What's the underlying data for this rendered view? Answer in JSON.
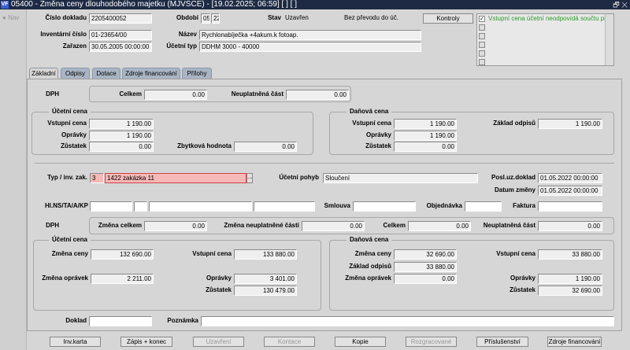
{
  "window": {
    "title": "05400 - Změna ceny dlouhodobého majetku (MJVSCE) - [19.02.2025; 06:59]  [ ]  [ ]",
    "controls": "🗗 ✕"
  },
  "nav": {
    "label": "Nav"
  },
  "header": {
    "cislo_dokladu": {
      "label": "Číslo dokladu",
      "value": "2205400052"
    },
    "obdobi": {
      "label": "Období",
      "month": "05",
      "year": "22"
    },
    "stav": {
      "label": "Stav",
      "value": "Uzavřen"
    },
    "prevod": "Bez převodu do úč.",
    "kontroly_button": "Kontroly",
    "inventarni_cislo": {
      "label": "Inventární číslo",
      "value": "01-23654/00"
    },
    "nazev": {
      "label": "Název",
      "value": "Rychlonabíječka +4akum.k fotoap."
    },
    "zarazen": {
      "label": "Zařazen",
      "value": "30.05.2005 00:00:00"
    },
    "ucetni_typ": {
      "label": "Účetní typ",
      "value": "DDHM 3000 - 40000"
    },
    "messages": [
      {
        "checked": true,
        "text": "Vstupní cena účetní neodpovídá součtu připojených"
      },
      {
        "checked": false,
        "text": ""
      },
      {
        "checked": false,
        "text": ""
      },
      {
        "checked": false,
        "text": ""
      },
      {
        "checked": false,
        "text": ""
      },
      {
        "checked": false,
        "text": ""
      }
    ]
  },
  "tabs": [
    "Základní",
    "Odpisy",
    "Dotace",
    "Zdroje financování",
    "Přílohy"
  ],
  "top": {
    "dph": {
      "label": "DPH",
      "celkem_label": "Celkem",
      "celkem": "0.00",
      "neupl_label": "Neuplatněná část",
      "neupl": "0.00"
    },
    "ucetni": {
      "title": "Účetní cena",
      "vstupni_label": "Vstupní cena",
      "vstupni": "1 190.00",
      "opravky_label": "Oprávky",
      "opravky": "1 190.00",
      "zustatek_label": "Zůstatek",
      "zustatek": "0.00",
      "zbytkova_label": "Zbytková hodnota",
      "zbytkova": "0.00"
    },
    "danova": {
      "title": "Daňová cena",
      "vstupni_label": "Vstupní cena",
      "vstupni": "1 190.00",
      "opravky_label": "Oprávky",
      "opravky": "1 190.00",
      "zustatek_label": "Zůstatek",
      "zustatek": "0.00",
      "zaklad_label": "Základ odpisů",
      "zaklad": "1 190.00"
    }
  },
  "change": {
    "typ_label": "Typ / inv. zak.",
    "typ": "3",
    "zakazka": "1422 zakázka 11",
    "ellipsis": "...",
    "pohyb_label": "Účetní pohyb",
    "pohyb": "Sloučení",
    "posl_label": "Posl.uz.doklad",
    "posl": "01.05.2022 00:00:00",
    "datum_label": "Datum změny",
    "datum": "01.05.2022 00:00:00",
    "hlns_label": "Hl.NS/TA/A/KP",
    "smlouva_label": "Smlouva",
    "objednavka_label": "Objednávka",
    "faktura_label": "Faktura",
    "dph": {
      "label": "DPH",
      "zmena_celkem_label": "Změna celkem",
      "zmena_celkem": "0.00",
      "zmena_neupl_label": "Změna neuplatněné části",
      "zmena_neupl": "0.00",
      "celkem_label": "Celkem",
      "celkem": "0.00",
      "neupl_label": "Neuplatněná část",
      "neupl": "0.00"
    },
    "ucetni": {
      "title": "Účetní cena",
      "zmena_ceny_label": "Změna ceny",
      "zmena_ceny": "132 690.00",
      "vstupni_label": "Vstupní cena",
      "vstupni": "133 880.00",
      "zmena_opravek_label": "Změna oprávek",
      "zmena_opravek": "2 211.00",
      "opravky_label": "Oprávky",
      "opravky": "3 401.00",
      "zustatek_label": "Zůstatek",
      "zustatek": "130 479.00"
    },
    "danova": {
      "title": "Daňová cena",
      "zmena_ceny_label": "Změna ceny",
      "zmena_ceny": "32 690.00",
      "zaklad_label": "Základ odpisů",
      "zaklad": "33 880.00",
      "zmena_opravek_label": "Změna oprávek",
      "zmena_opravek": "0.00",
      "vstupni_label": "Vstupní cena",
      "vstupni": "33 880.00",
      "opravky_label": "Oprávky",
      "opravky": "1 190.00",
      "zustatek_label": "Zůstatek",
      "zustatek": "32 690.00"
    },
    "doklad_label": "Doklad",
    "poznamka_label": "Poznámka"
  },
  "buttons": [
    {
      "label": "Inv.karta",
      "enabled": true
    },
    {
      "label": "Zápis + konec",
      "enabled": true
    },
    {
      "label": "Uzavření",
      "enabled": false
    },
    {
      "label": "Kontace",
      "enabled": false
    },
    {
      "label": "Kopie",
      "enabled": true
    },
    {
      "label": "Rozgracované",
      "enabled": false
    },
    {
      "label": "Příslušenství",
      "enabled": true
    },
    {
      "label": "Zdroje financování",
      "enabled": true
    }
  ]
}
